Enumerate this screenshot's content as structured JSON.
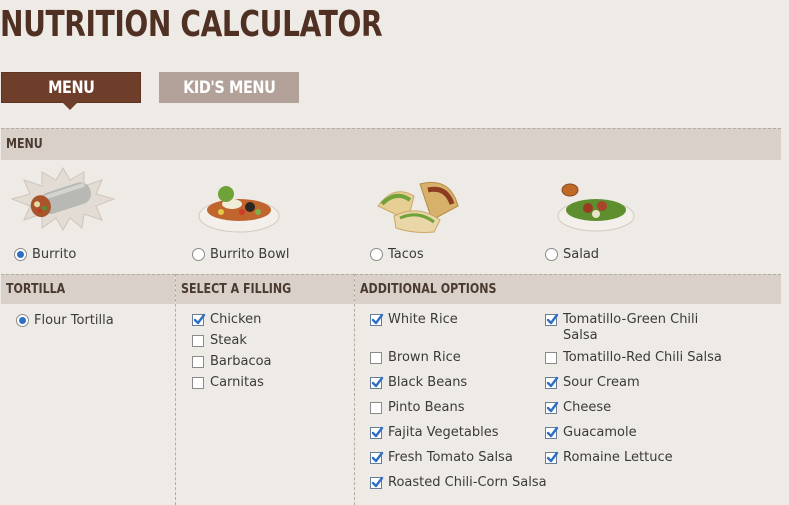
{
  "title": "NUTRITION CALCULATOR",
  "tabs": {
    "menu": "MENU",
    "kids": "KID'S MENU"
  },
  "menu_section": {
    "header": "MENU",
    "items": [
      {
        "label": "Burrito",
        "selected": true
      },
      {
        "label": "Burrito Bowl",
        "selected": false
      },
      {
        "label": "Tacos",
        "selected": false
      },
      {
        "label": "Salad",
        "selected": false
      }
    ]
  },
  "tortilla": {
    "header": "TORTILLA",
    "options": [
      {
        "label": "Flour Tortilla",
        "selected": true
      }
    ]
  },
  "filling": {
    "header": "SELECT A FILLING",
    "options": [
      {
        "label": "Chicken",
        "checked": true
      },
      {
        "label": "Steak",
        "checked": false
      },
      {
        "label": "Barbacoa",
        "checked": false
      },
      {
        "label": "Carnitas",
        "checked": false
      }
    ]
  },
  "additional": {
    "header": "ADDITIONAL OPTIONS",
    "col1": [
      {
        "label": "White Rice",
        "checked": true
      },
      {
        "label": "Brown Rice",
        "checked": false
      },
      {
        "label": "Black Beans",
        "checked": true
      },
      {
        "label": "Pinto Beans",
        "checked": false
      },
      {
        "label": "Fajita Vegetables",
        "checked": true
      },
      {
        "label": "Fresh Tomato Salsa",
        "checked": true
      },
      {
        "label": "Roasted Chili-Corn Salsa",
        "checked": true
      }
    ],
    "col2": [
      {
        "label": "Tomatillo-Green Chili Salsa",
        "checked": true
      },
      {
        "label": "Tomatillo-Red Chili Salsa",
        "checked": false
      },
      {
        "label": "Sour Cream",
        "checked": true
      },
      {
        "label": "Cheese",
        "checked": true
      },
      {
        "label": "Guacamole",
        "checked": true
      },
      {
        "label": "Romaine Lettuce",
        "checked": true
      }
    ]
  },
  "colors": {
    "brand_brown": "#6e3e2b",
    "check_blue": "#2d6fc4"
  }
}
